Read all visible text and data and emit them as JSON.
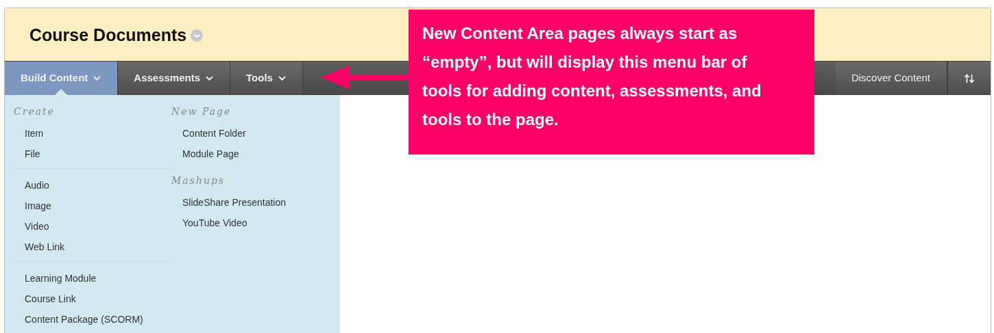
{
  "header": {
    "title": "Course Documents",
    "has_options": true
  },
  "nav": [
    {
      "label": "Build Content",
      "kind": "menu",
      "selected": true
    },
    {
      "label": "Assessments",
      "kind": "menu",
      "selected": false
    },
    {
      "label": "Tools",
      "kind": "menu",
      "selected": false
    },
    {
      "kind": "spacer"
    },
    {
      "label": "Discover Content",
      "kind": "link",
      "selected": false
    },
    {
      "kind": "sort"
    }
  ],
  "build_menu": {
    "columns": [
      {
        "sections": [
          {
            "heading": "Create",
            "groups": [
              [
                "Item",
                "File"
              ],
              [
                "Audio",
                "Image",
                "Video",
                "Web Link"
              ],
              [
                "Learning Module",
                "Course Link",
                "Content Package (SCORM)"
              ]
            ]
          }
        ]
      },
      {
        "sections": [
          {
            "heading": "New Page",
            "groups": [
              [
                "Content Folder",
                "Module Page"
              ]
            ]
          },
          {
            "heading": "Mashups",
            "groups": [
              [
                "SlideShare Presentation",
                "YouTube Video"
              ]
            ]
          }
        ]
      }
    ]
  },
  "callout": {
    "text": "New Content Area pages always start as “empty”, but will display this menu bar of tools for adding content, assessments, and tools to the page.",
    "color": "#ff0066"
  }
}
